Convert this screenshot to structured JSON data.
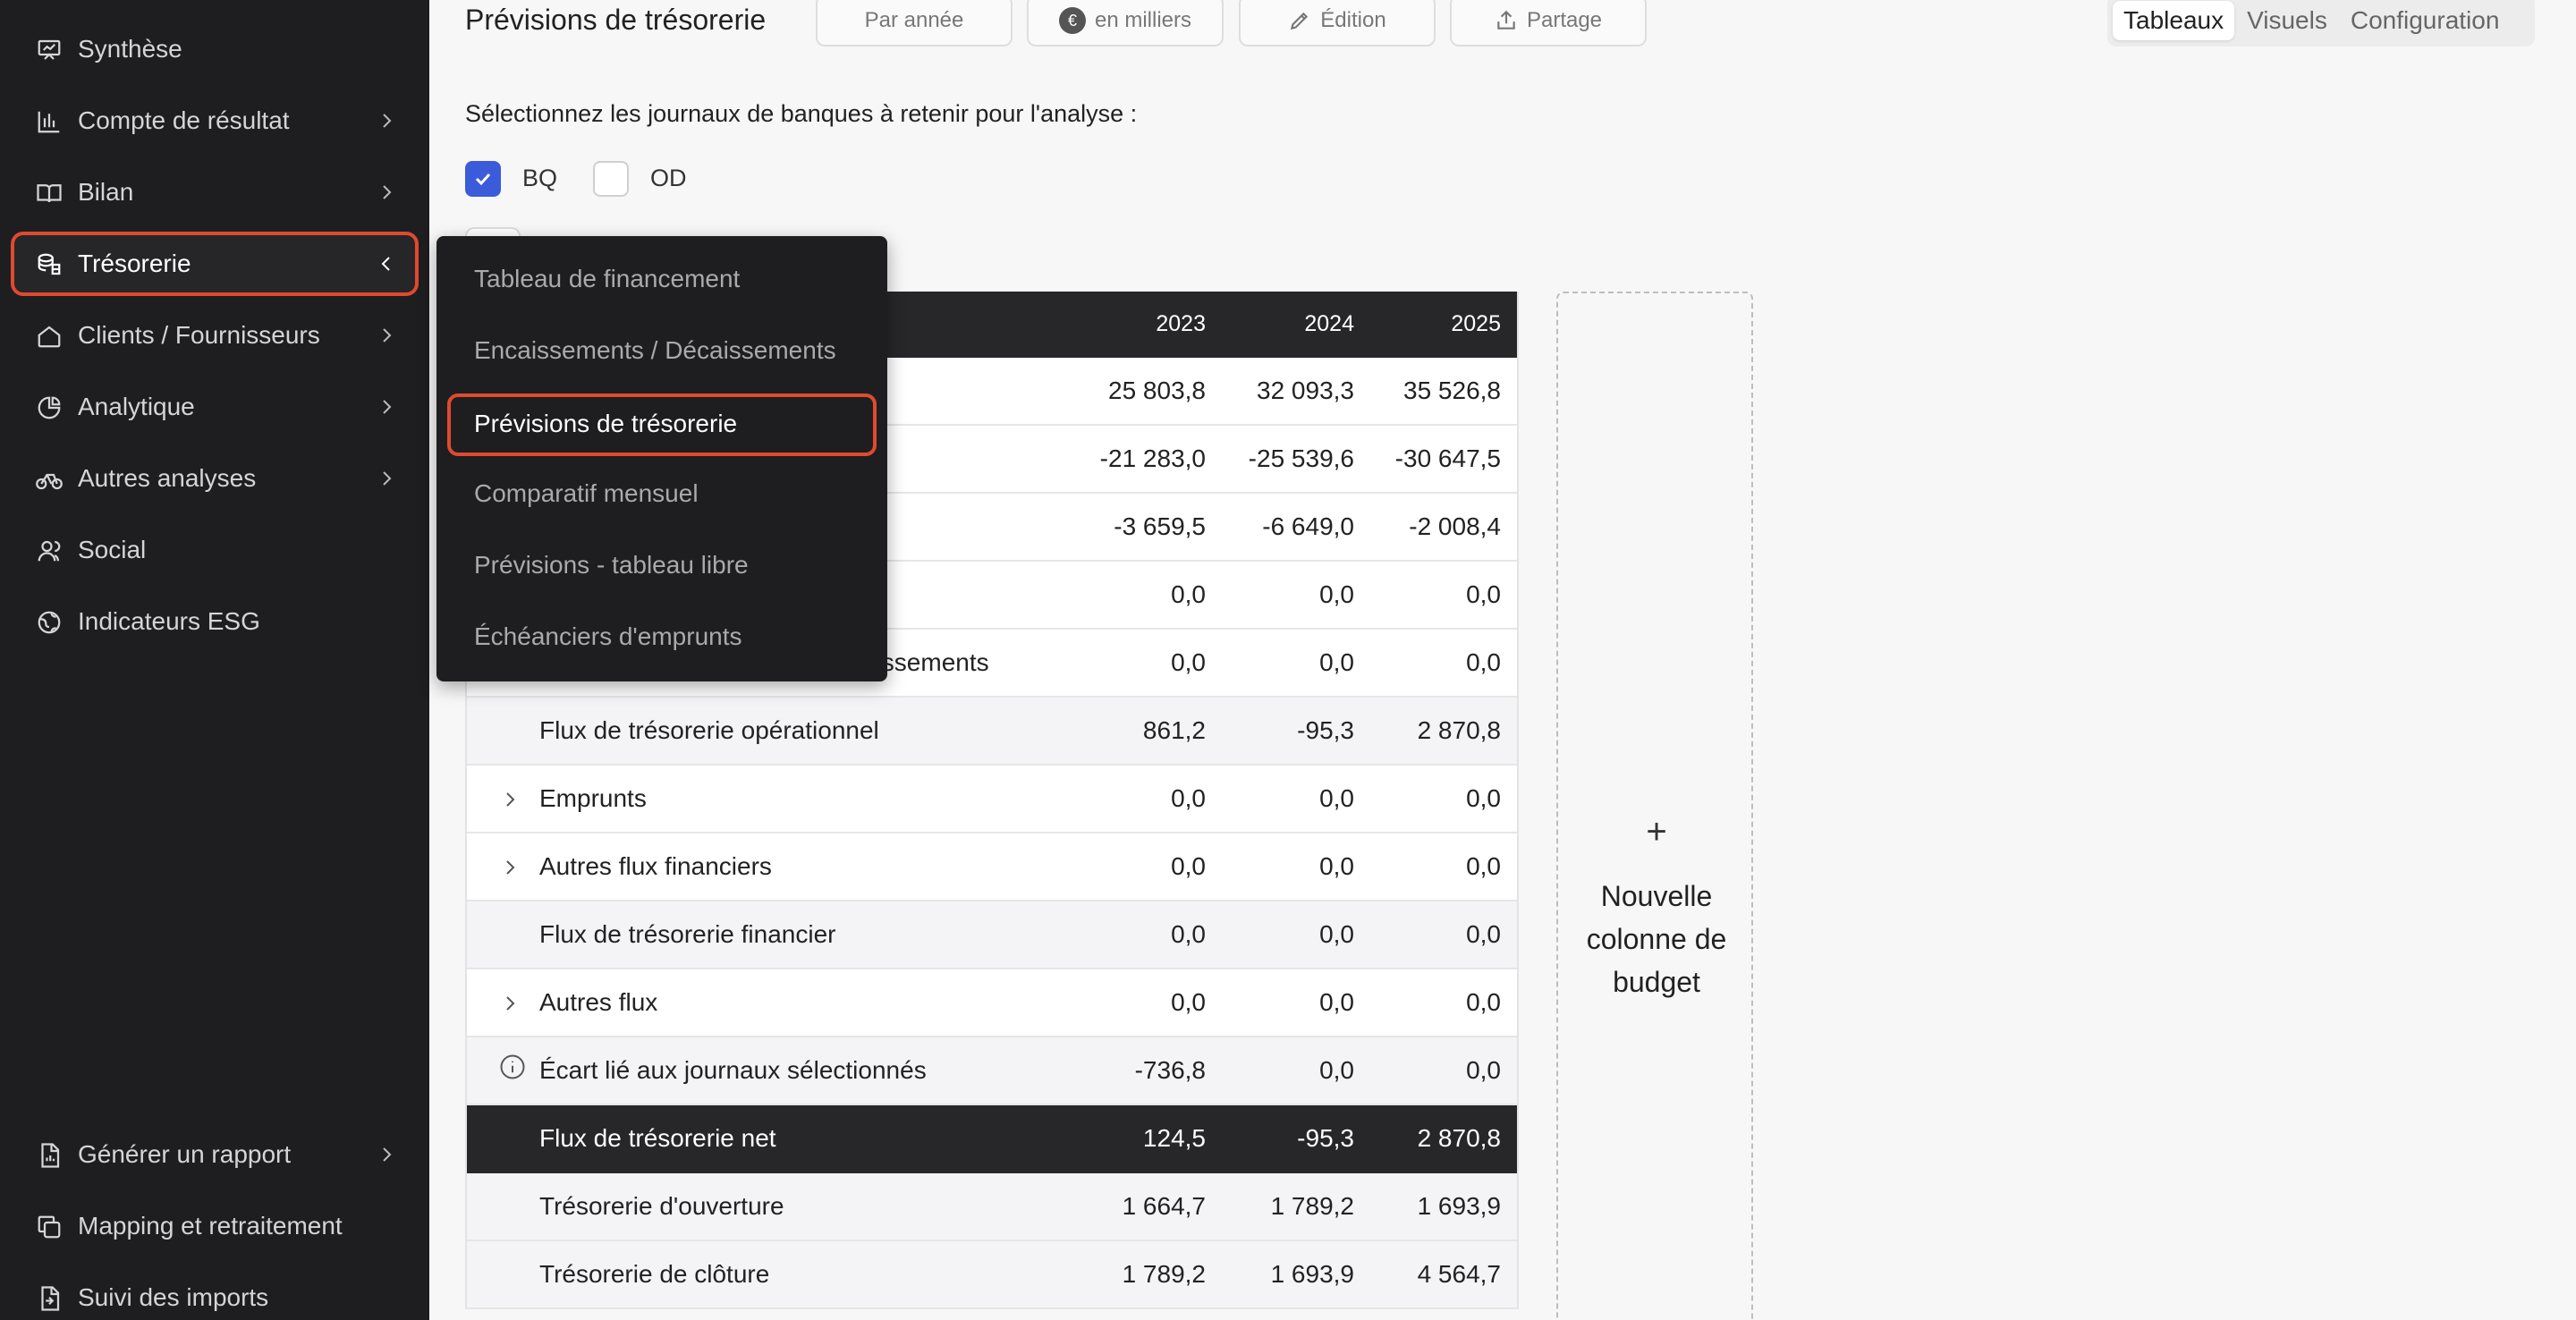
{
  "sidebar": {
    "items": [
      {
        "label": "Synthèse",
        "icon": "presentation-icon",
        "chevron": false
      },
      {
        "label": "Compte de résultat",
        "icon": "bar-chart-icon",
        "chevron": true
      },
      {
        "label": "Bilan",
        "icon": "book-icon",
        "chevron": true
      },
      {
        "label": "Trésorerie",
        "icon": "coins-icon",
        "chevron": true,
        "active": true
      },
      {
        "label": "Clients / Fournisseurs",
        "icon": "home-icon",
        "chevron": true
      },
      {
        "label": "Analytique",
        "icon": "pie-chart-icon",
        "chevron": true
      },
      {
        "label": "Autres analyses",
        "icon": "bicycle-icon",
        "chevron": true
      },
      {
        "label": "Social",
        "icon": "users-icon",
        "chevron": false
      },
      {
        "label": "Indicateurs ESG",
        "icon": "globe-icon",
        "chevron": false
      }
    ],
    "bottom_items": [
      {
        "label": "Générer un rapport",
        "icon": "report-icon",
        "chevron": true
      },
      {
        "label": "Mapping et retraitement",
        "icon": "copy-icon",
        "chevron": false
      },
      {
        "label": "Suivi des imports",
        "icon": "import-icon",
        "chevron": false
      }
    ]
  },
  "header": {
    "title": "Prévisions de trésorerie",
    "period_button": "Par année",
    "unit_button": "en milliers",
    "unit_badge": "€",
    "edit_button": "Édition",
    "share_button": "Partage",
    "views": [
      "Tableaux",
      "Visuels",
      "Configuration"
    ],
    "selected_view": "Tableaux"
  },
  "filters": {
    "instruction": "Sélectionnez les journaux de banques à retenir pour l'analyse :",
    "journals": [
      {
        "label": "BQ",
        "checked": true
      },
      {
        "label": "OD",
        "checked": false
      }
    ]
  },
  "table": {
    "years": [
      "2023",
      "2024",
      "2025"
    ],
    "rows": [
      {
        "label": "",
        "values": [
          "25 803,8",
          "32 093,3",
          "35 526,8"
        ],
        "style": "normal"
      },
      {
        "label": "",
        "values": [
          "-21 283,0",
          "-25 539,6",
          "-30 647,5"
        ],
        "style": "normal"
      },
      {
        "label": "",
        "values": [
          "-3 659,5",
          "-6 649,0",
          "-2 008,4"
        ],
        "style": "normal"
      },
      {
        "label": "",
        "values": [
          "0,0",
          "0,0",
          "0,0"
        ],
        "style": "normal"
      },
      {
        "label": "aissements",
        "values": [
          "0,0",
          "0,0",
          "0,0"
        ],
        "style": "normal"
      },
      {
        "label": "Flux de trésorerie opérationnel",
        "values": [
          "861,2",
          "-95,3",
          "2 870,8"
        ],
        "style": "shade"
      },
      {
        "label": "Emprunts",
        "values": [
          "0,0",
          "0,0",
          "0,0"
        ],
        "style": "normal",
        "expandable": true
      },
      {
        "label": "Autres flux financiers",
        "values": [
          "0,0",
          "0,0",
          "0,0"
        ],
        "style": "normal",
        "expandable": true
      },
      {
        "label": "Flux de trésorerie financier",
        "values": [
          "0,0",
          "0,0",
          "0,0"
        ],
        "style": "shade"
      },
      {
        "label": "Autres flux",
        "values": [
          "0,0",
          "0,0",
          "0,0"
        ],
        "style": "normal",
        "expandable": true
      },
      {
        "label": "Écart lié aux journaux sélectionnés",
        "values": [
          "-736,8",
          "0,0",
          "0,0"
        ],
        "style": "shade",
        "info": true
      },
      {
        "label": "Flux de trésorerie net",
        "values": [
          "124,5",
          "-95,3",
          "2 870,8"
        ],
        "style": "dark"
      },
      {
        "label": "Trésorerie d'ouverture",
        "values": [
          "1 664,7",
          "1 789,2",
          "1 693,9"
        ],
        "style": "shade"
      },
      {
        "label": "Trésorerie de clôture",
        "values": [
          "1 789,2",
          "1 693,9",
          "4 564,7"
        ],
        "style": "shade"
      }
    ]
  },
  "new_budget_column": {
    "plus": "+",
    "label": "Nouvelle colonne de budget"
  },
  "dropdown": {
    "items": [
      {
        "label": "Tableau de financement",
        "selected": false
      },
      {
        "label": "Encaissements / Décaissements",
        "selected": false
      },
      {
        "label": "Prévisions de trésorerie",
        "selected": true
      },
      {
        "label": "Comparatif mensuel",
        "selected": false
      },
      {
        "label": "Prévisions - tableau libre",
        "selected": false
      },
      {
        "label": "Échéanciers d'emprunts",
        "selected": false
      }
    ]
  },
  "colors": {
    "sidebar_bg": "#1e1e20",
    "highlight": "#e04a2f",
    "checkbox": "#3b5bdb",
    "dark_row": "#27272a"
  }
}
